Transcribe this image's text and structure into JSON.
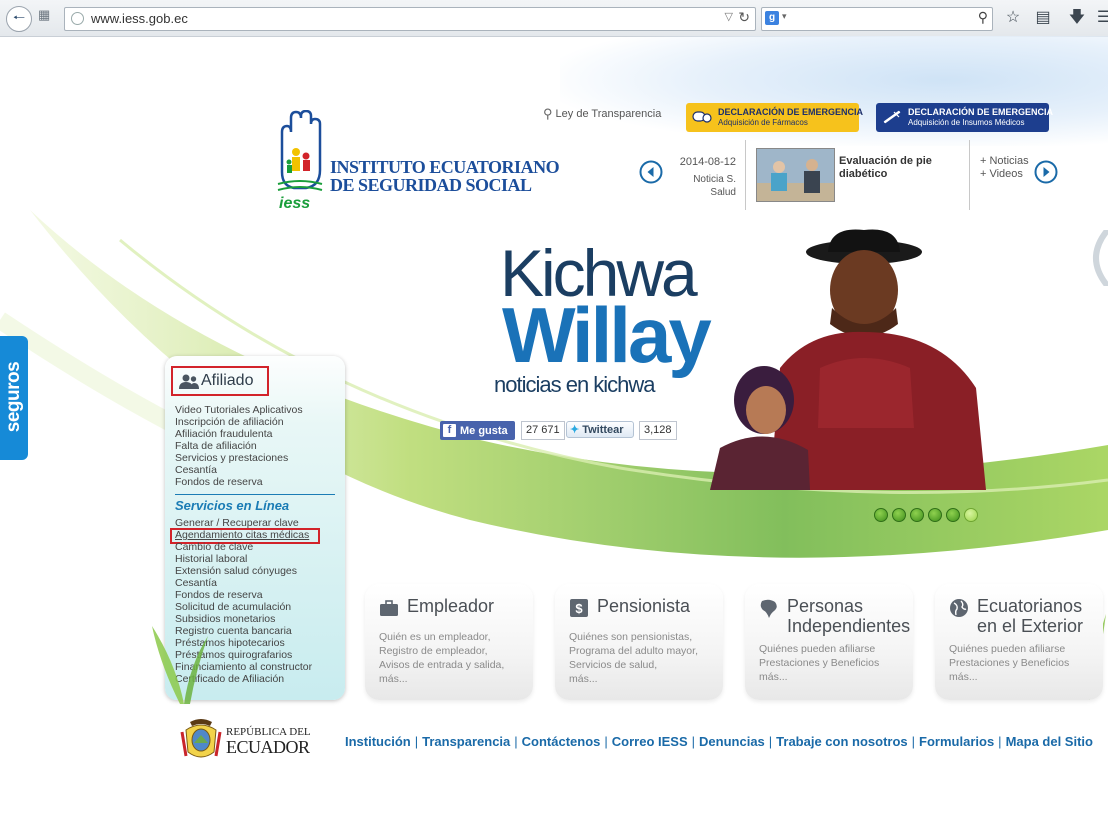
{
  "browser": {
    "url": "www.iess.gob.ec",
    "search_engine_letter": "g"
  },
  "header": {
    "transparencia_label": "Ley de Transparencia",
    "emergency_buttons": [
      {
        "title": "DECLARACIÓN DE EMERGENCIA",
        "subtitle": "Adquisición de Fármacos",
        "bg": "#f6c21c",
        "fg": "#1d2f6a"
      },
      {
        "title": "DECLARACIÓN DE EMERGENCIA",
        "subtitle": "Adquisición de Insumos Médicos",
        "bg": "#1d3e8e",
        "fg": "#ffffff"
      }
    ],
    "logo": {
      "line1": "INSTITUTO ECUATORIANO",
      "line2": "DE SEGURIDAD SOCIAL",
      "acronym": "iess"
    }
  },
  "news": {
    "date": "2014-08-12",
    "tag": "Noticia S. Salud",
    "title": "Evaluación de pie diabético",
    "more_news": "+ Noticias",
    "more_videos": "+ Videos"
  },
  "hero": {
    "line1": "Kichwa",
    "line2": "Willay",
    "line3": "noticias en kichwa"
  },
  "social": {
    "fb_label": "Me gusta",
    "fb_count": "27 671",
    "tw_label": "Twittear",
    "tw_count": "3,128"
  },
  "carousel": {
    "slides_total": 6,
    "active_index": 5
  },
  "side_tab": {
    "label": "seguros"
  },
  "afiliado": {
    "title": "Afiliado",
    "links": [
      "Video Tutoriales Aplicativos",
      "Inscripción de afiliación",
      "Afiliación fraudulenta",
      "Falta de afiliación",
      "Servicios y prestaciones",
      "Cesantía",
      "Fondos de reserva"
    ],
    "servicios_title": "Servicios en Línea",
    "servicios_links": [
      "Generar / Recuperar clave",
      "Agendamiento citas médicas",
      "Cambio de clave",
      "Historial laboral",
      "Extensión salud cónyuges",
      "Cesantía",
      "Fondos de reserva",
      "Solicitud de acumulación",
      "Subsidios monetarios",
      "Registro cuenta bancaria",
      "Préstamos hipotecarios",
      "Préstamos quirografarios",
      "Financiamiento al constructor",
      "Certificado de Afiliación"
    ]
  },
  "cards": [
    {
      "title": [
        "Empleador"
      ],
      "icon": "briefcase-icon",
      "lines": [
        "Quién es un empleador,",
        "Registro de empleador,",
        "Avisos de entrada y salida,",
        "más..."
      ]
    },
    {
      "title": [
        "Pensionista"
      ],
      "icon": "money-icon",
      "lines": [
        "Quiénes son pensionistas,",
        "Programa del adulto mayor,",
        "Servicios de salud,",
        "más..."
      ]
    },
    {
      "title": [
        "Personas",
        "Independientes"
      ],
      "icon": "map-icon",
      "lines": [
        "Quiénes pueden afiliarse",
        "Prestaciones y Beneficios",
        "más..."
      ]
    },
    {
      "title": [
        "Ecuatorianos",
        "en el Exterior"
      ],
      "icon": "globe-icon",
      "lines": [
        "Quiénes pueden afiliarse",
        "Prestaciones y Beneficios",
        "más..."
      ]
    }
  ],
  "footer": {
    "republica_line1": "REPÚBLICA DEL",
    "republica_line2": "ECUADOR",
    "links": [
      "Institución",
      "Transparencia",
      "Contáctenos",
      "Correo IESS",
      "Denuncias",
      "Trabaje con nosotros",
      "Formularios",
      "Mapa del Sitio"
    ]
  },
  "colors": {
    "brand_blue": "#1c4e9b",
    "link_blue": "#1a6aa8",
    "highlight_red": "#d2232a",
    "hero_green": "#6cb33f"
  }
}
